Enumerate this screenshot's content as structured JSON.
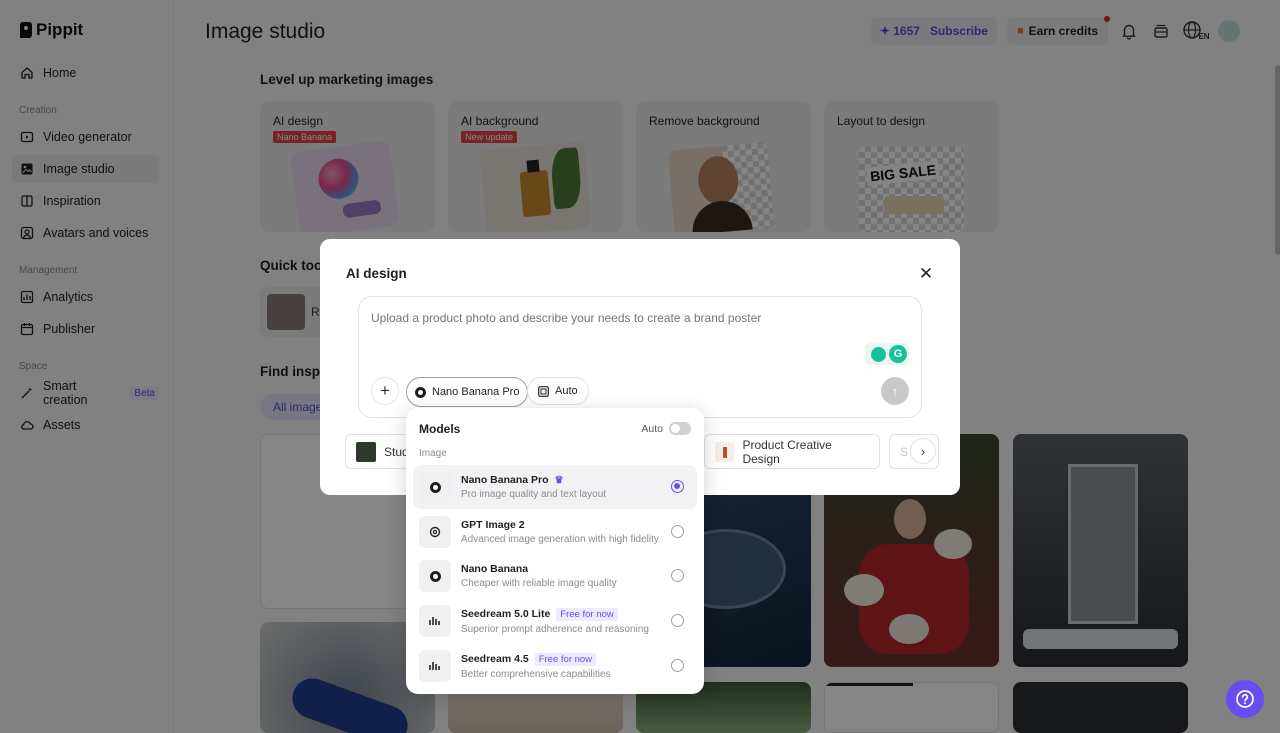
{
  "app": {
    "brand": "Pippit"
  },
  "sidebar": {
    "items": [
      {
        "label": "Home",
        "icon": "home-icon"
      },
      {
        "label": "Video generator",
        "icon": "video-icon"
      },
      {
        "label": "Image studio",
        "icon": "image-icon"
      },
      {
        "label": "Inspiration",
        "icon": "book-icon"
      },
      {
        "label": "Avatars and voices",
        "icon": "avatar-icon"
      },
      {
        "label": "Analytics",
        "icon": "analytics-icon"
      },
      {
        "label": "Publisher",
        "icon": "calendar-icon"
      },
      {
        "label": "Smart creation",
        "icon": "wand-icon"
      },
      {
        "label": "Assets",
        "icon": "cloud-icon"
      }
    ],
    "sections": {
      "creation": "Creation",
      "management": "Management",
      "space": "Space"
    },
    "beta_badge": "Beta"
  },
  "header": {
    "title": "Image studio",
    "credits": "1657",
    "subscribe": "Subscribe",
    "earn_credits": "Earn credits",
    "lang": "EN"
  },
  "main": {
    "section1": "Level up marketing images",
    "cards": [
      {
        "title": "AI design",
        "tag": "Nano Banana"
      },
      {
        "title": "AI background",
        "tag": "New update"
      },
      {
        "title": "Remove background",
        "tag": ""
      },
      {
        "title": "Layout to design",
        "tag": ""
      }
    ],
    "big_sale": "BIG SALE",
    "quick_tools": "Quick too",
    "find_inspiration": "Find inspi",
    "all_images": "All image",
    "quick_item": "Re"
  },
  "modal": {
    "title": "AI design",
    "placeholder": "Upload a product photo and describe your needs to create a brand poster",
    "model_button": "Nano Banana Pro",
    "auto_button": "Auto",
    "chips": [
      "Stud",
      "Product Creative Design",
      "S"
    ]
  },
  "dropdown": {
    "title": "Models",
    "auto_label": "Auto",
    "section": "Image",
    "options": [
      {
        "name": "Nano Banana Pro",
        "desc": "Pro image quality and text layout",
        "badge": "",
        "selected": true
      },
      {
        "name": "GPT Image 2",
        "desc": "Advanced image generation with high fidelity",
        "badge": "",
        "selected": false
      },
      {
        "name": "Nano Banana",
        "desc": "Cheaper with reliable image quality",
        "badge": "",
        "selected": false
      },
      {
        "name": "Seedream 5.0 Lite",
        "desc": "Superior prompt adherence and reasoning",
        "badge": "Free for now",
        "selected": false
      },
      {
        "name": "Seedream 4.5",
        "desc": "Better comprehensive capabilities",
        "badge": "Free for now",
        "selected": false
      }
    ]
  },
  "colors": {
    "accent": "#6a4cf5",
    "tag_red": "#e64545"
  }
}
